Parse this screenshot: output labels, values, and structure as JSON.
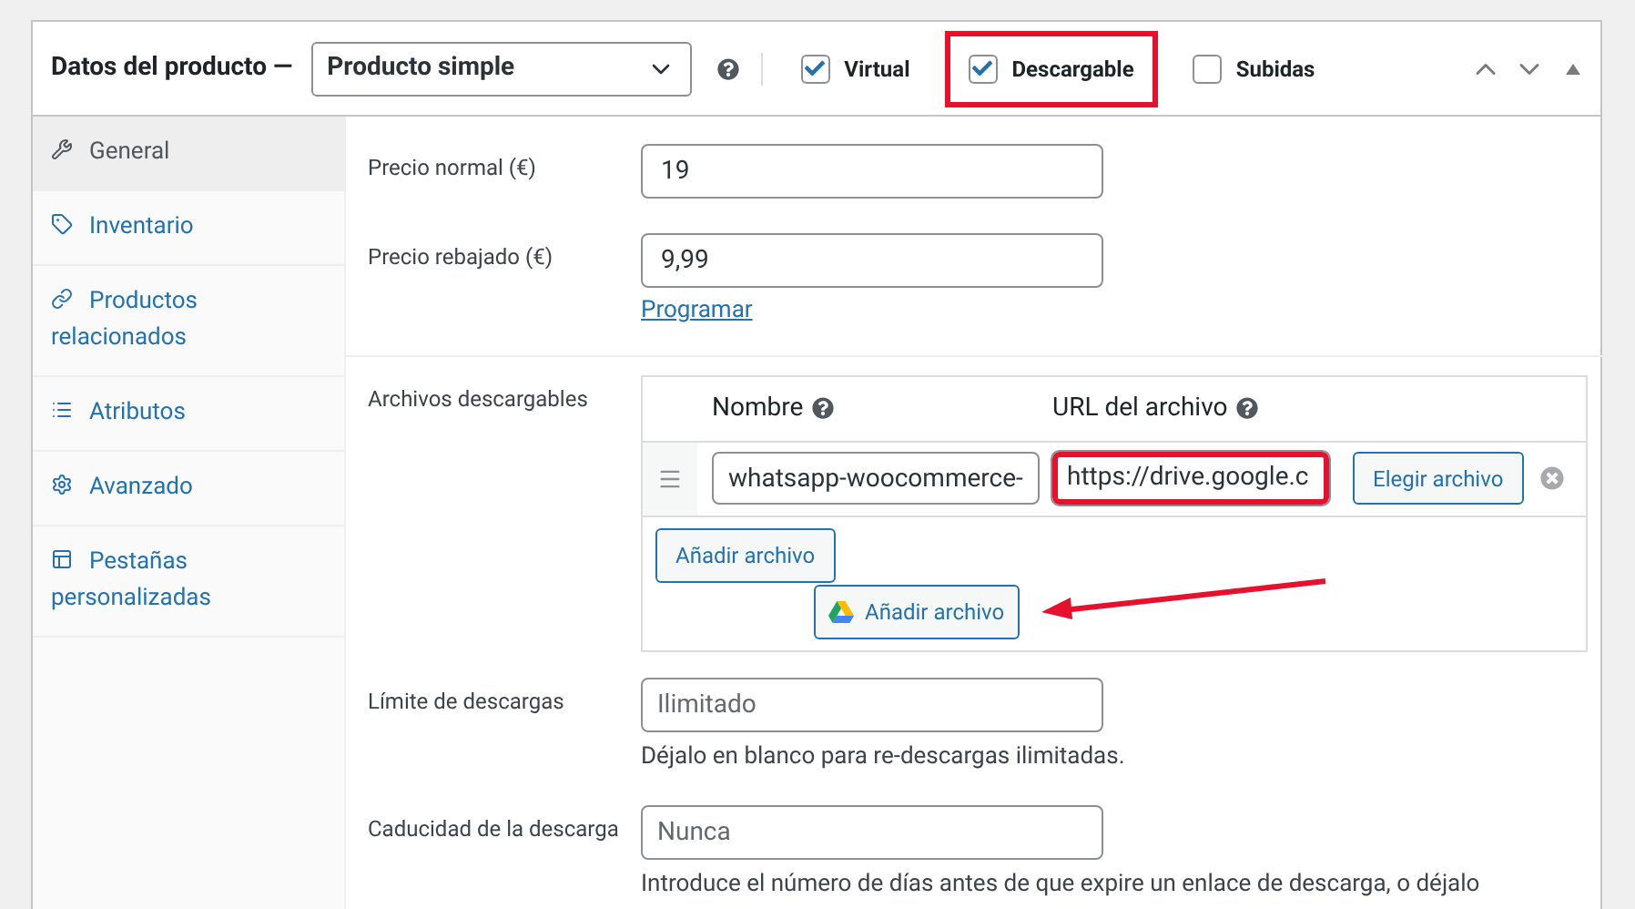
{
  "header": {
    "title": "Datos del producto —",
    "product_type": "Producto simple",
    "options": [
      {
        "label": "Virtual",
        "checked": true,
        "highlighted": false
      },
      {
        "label": "Descargable",
        "checked": true,
        "highlighted": true
      },
      {
        "label": "Subidas",
        "checked": false,
        "highlighted": false
      }
    ]
  },
  "sidebar": {
    "items": [
      {
        "label": "General",
        "selected": true
      },
      {
        "label": "Inventario",
        "selected": false
      },
      {
        "label": "Productos relacionados",
        "selected": false
      },
      {
        "label": "Atributos",
        "selected": false
      },
      {
        "label": "Avanzado",
        "selected": false
      },
      {
        "label": "Pestañas personalizadas",
        "selected": false
      }
    ]
  },
  "pricing": [
    {
      "label": "Precio normal (€)",
      "value": "19"
    },
    {
      "label": "Precio rebajado (€)",
      "value": "9,99",
      "link": "Programar"
    }
  ],
  "downloads": {
    "label": "Archivos descargables",
    "columns": [
      "Nombre",
      "URL del archivo"
    ],
    "files": [
      {
        "name": "whatsapp-woocommerce-",
        "url": "https://drive.google.c",
        "url_highlighted": true,
        "choose_button": "Elegir archivo"
      }
    ],
    "add_button": "Añadir archivo",
    "drive_button": "Añadir archivo"
  },
  "limits": [
    {
      "label": "Límite de descargas",
      "placeholder": "Ilimitado",
      "help": "Déjalo en blanco para re-descargas ilimitadas."
    },
    {
      "label": "Caducidad de la descarga",
      "placeholder": "Nunca",
      "help": "Introduce el número de días antes de que expire un enlace de descarga, o déjalo"
    }
  ]
}
